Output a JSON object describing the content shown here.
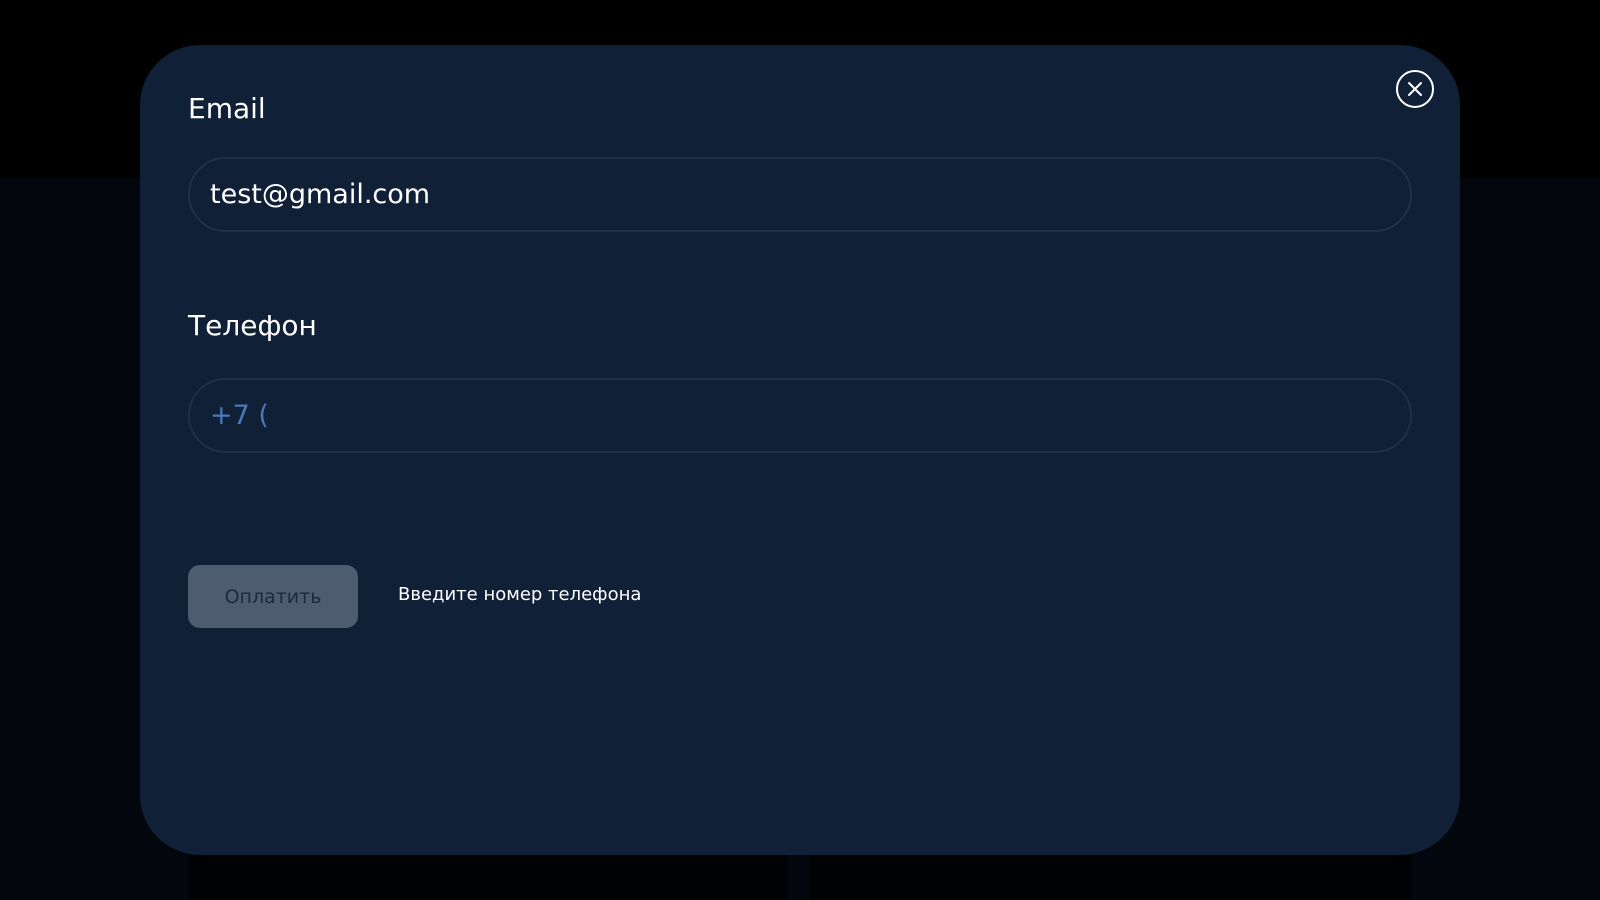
{
  "colors": {
    "backdrop": "#000000",
    "modal_bg": "#0f2037",
    "field_border": "#1f3047",
    "text_primary": "#ffffff",
    "phone_prefix": "#4a78b8",
    "button_disabled_bg": "#4d5c6f",
    "button_disabled_text": "#1b2a3d"
  },
  "modal": {
    "close_icon": "close-icon",
    "email": {
      "label": "Email",
      "value": "test@gmail.com",
      "placeholder": ""
    },
    "phone": {
      "label": "Телефон",
      "value": "+7 (",
      "placeholder": ""
    },
    "pay_button": {
      "label": "Оплатить",
      "state": "disabled"
    },
    "hint": "Введите номер телефона"
  }
}
